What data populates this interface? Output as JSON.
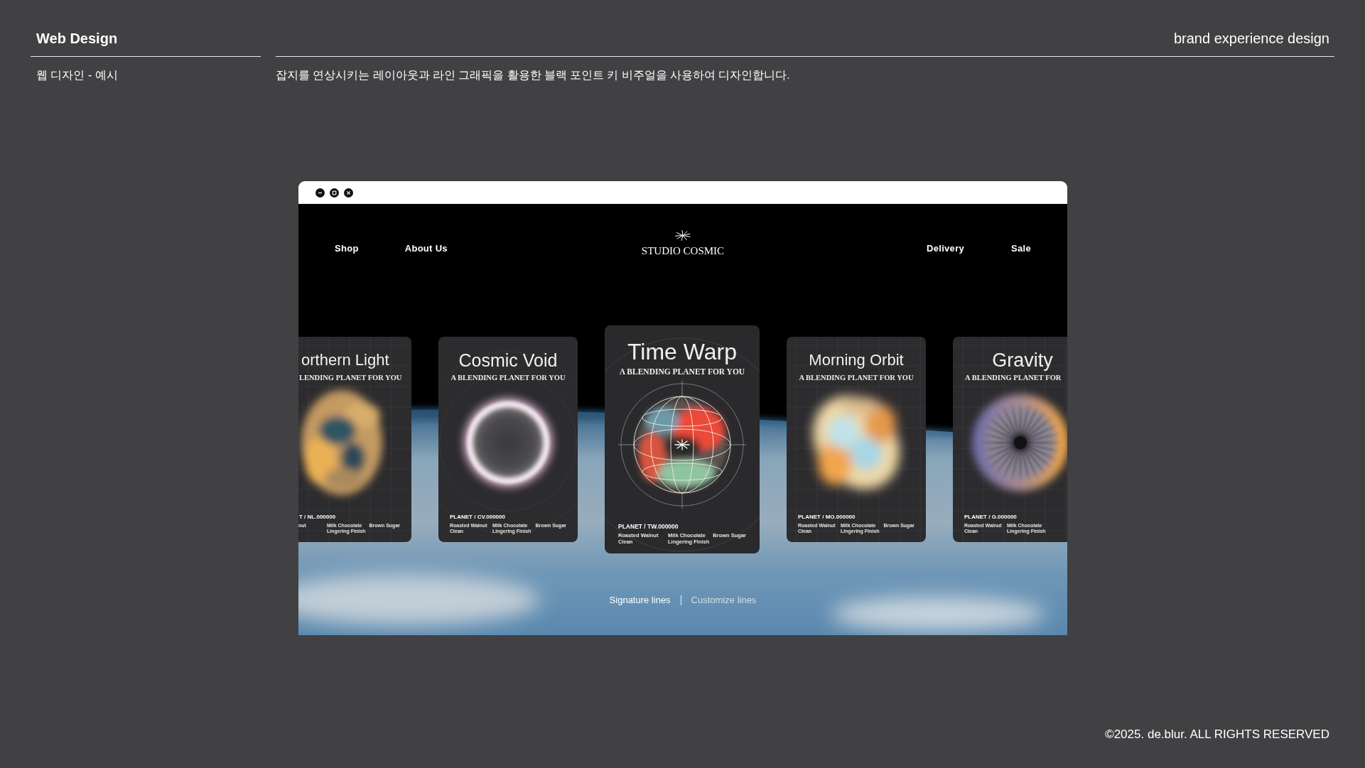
{
  "header": {
    "title": "Web Design",
    "tagline": "brand experience design",
    "subtitle": "웹 디자인 - 예시",
    "description": "잡지를 연상시키는 레이아웃과 라인 그래픽을 활용한 블랙 포인트 키 비주얼을 사용하여 디자인합니다."
  },
  "browser_window": {
    "nav": {
      "left_links": [
        "Shop",
        "About Us"
      ],
      "logo": "STUDIO COSMIC",
      "right_links": [
        "Delivery",
        "Sale"
      ]
    },
    "cards": [
      {
        "kind": "swirl",
        "selected": false,
        "title": "orthern Light",
        "subtitle": "LENDING PLANET FOR YOU",
        "code": "T / NL.000000",
        "note_columns": [
          [
            "nut"
          ],
          [
            "Milk Chocolate",
            "Lingering Finish"
          ],
          [
            "Brown Sugar"
          ]
        ]
      },
      {
        "kind": "ring",
        "selected": false,
        "title": "Cosmic Void",
        "subtitle": "A BLENDING PLANET FOR YOU",
        "code": "PLANET / CV.000000",
        "note_columns": [
          [
            "Roasted Walnut",
            "Clean"
          ],
          [
            "Milk Chocolate",
            "Lingering Finish"
          ],
          [
            "Brown Sugar"
          ]
        ]
      },
      {
        "kind": "globe",
        "selected": true,
        "title": "Time Warp",
        "subtitle": "A BLENDING PLANET FOR YOU",
        "code": "PLANET / TW.000000",
        "note_columns": [
          [
            "Roasted Walnut",
            "Clean"
          ],
          [
            "Milk Chocolate",
            "Lingering Finish"
          ],
          [
            "Brown Sugar"
          ]
        ]
      },
      {
        "kind": "bloom",
        "selected": false,
        "title": "Morning Orbit",
        "subtitle": "A BLENDING PLANET FOR YOU",
        "code": "PLANET / MO.000000",
        "note_columns": [
          [
            "Roasted Walnut",
            "Clean"
          ],
          [
            "Milk Chocolate",
            "Lingering Finish"
          ],
          [
            "Brown Sugar"
          ]
        ]
      },
      {
        "kind": "burst",
        "selected": false,
        "title": "Gravity",
        "subtitle": "A BLENDING PLANET FOR",
        "code": "PLANET / G.000000",
        "note_columns": [
          [
            "Roasted Walnut",
            "Clean"
          ],
          [
            "Milk Chocolate",
            "Lingering Finish"
          ]
        ]
      }
    ],
    "tabs": [
      {
        "label": "Signature lines",
        "selected": true
      },
      {
        "label": "Customize lines",
        "selected": false
      }
    ]
  },
  "footer": {
    "copyright": "©2025. de.blur. ALL RIGHTS RESERVED"
  }
}
